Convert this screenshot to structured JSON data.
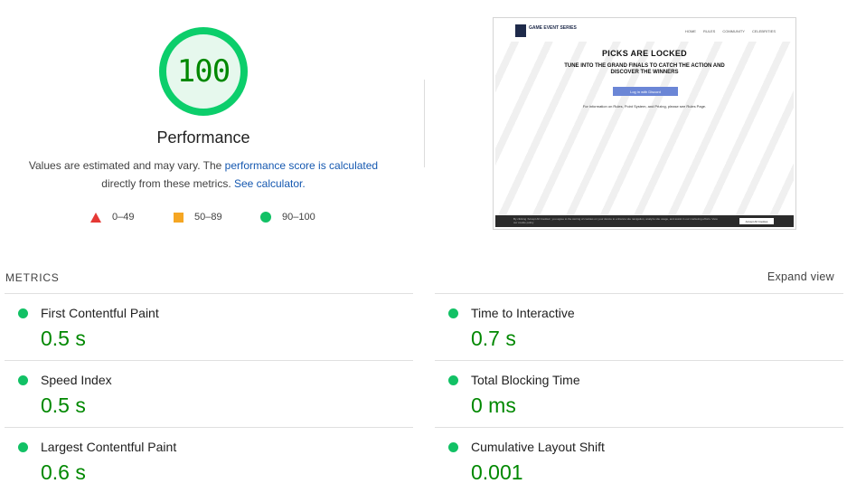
{
  "score": {
    "value": "100",
    "fraction": 1.0,
    "ring_color": "#0cce6b",
    "fill_color": "#e6f8ed",
    "text_color": "#008800"
  },
  "performance": {
    "title": "Performance",
    "desc_text1": "Values are estimated and may vary. The ",
    "desc_link1": "performance score is calculated",
    "desc_text2": " directly from these metrics. ",
    "desc_link2": "See calculator."
  },
  "legend": [
    {
      "shape": "triangle-red",
      "label": "0–49"
    },
    {
      "shape": "square-orange",
      "label": "50–89"
    },
    {
      "shape": "circle-green",
      "label": "90–100"
    }
  ],
  "screenshot": {
    "logo_text": "GAME EVENT SERIES",
    "nav_links": [
      "HOME",
      "RULES",
      "COMMUNITY",
      "CELEBRITIES"
    ],
    "headline": "PICKS ARE LOCKED",
    "subheadline": "TUNE INTO THE GRAND FINALS TO CATCH THE ACTION AND DISCOVER THE WINNERS",
    "button": "Log in with Discord",
    "info": "For information on Rules, Point System, and Prizing, please see Rules Page.",
    "cookie_text": "By clicking 'Accept All Cookies', you agree to the storing of cookies on your device to enhance site navigation, analyze site usage, and assist in our marketing efforts. View our cookie policy",
    "cookie_button": "Accept All Cookies"
  },
  "metrics": {
    "header": "METRICS",
    "expand": "Expand view",
    "items": [
      {
        "label": "First Contentful Paint",
        "value": "0.5 s"
      },
      {
        "label": "Time to Interactive",
        "value": "0.7 s"
      },
      {
        "label": "Speed Index",
        "value": "0.5 s"
      },
      {
        "label": "Total Blocking Time",
        "value": "0 ms"
      },
      {
        "label": "Largest Contentful Paint",
        "value": "0.6 s"
      },
      {
        "label": "Cumulative Layout Shift",
        "value": "0.001"
      }
    ]
  }
}
